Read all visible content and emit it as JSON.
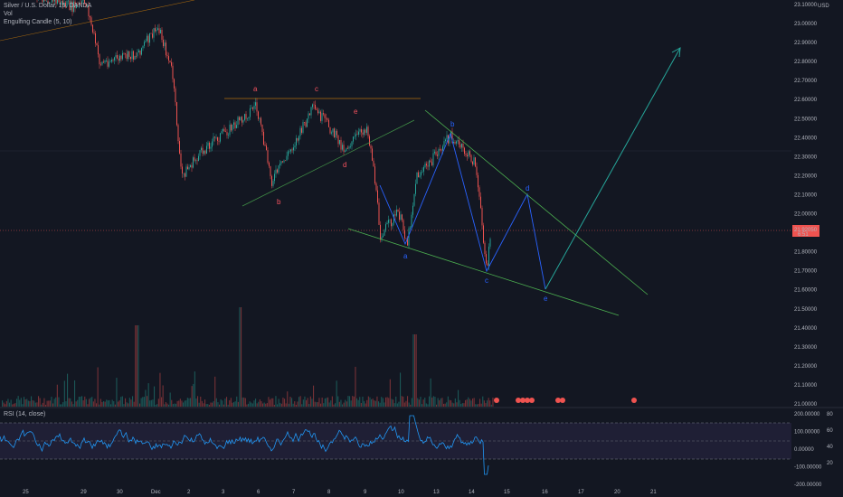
{
  "legend": {
    "symbol": "Silver / U.S. Dollar, 15, OANDA",
    "vol": "Vol",
    "indicator": "Engulfing Candle (5, 10)",
    "rsi": "RSI (14, close)"
  },
  "price_axis": {
    "currency": "USD",
    "current_price": "21.92050",
    "current_sub": "6:51"
  },
  "x_ticks": [
    "25",
    "29",
    "30",
    "Dec",
    "2",
    "3",
    "6",
    "7",
    "8",
    "9",
    "10",
    "13",
    "14",
    "15",
    "16",
    "17",
    "20",
    "21"
  ],
  "rsi_ticks": [
    "200.00000",
    "100.00000",
    "0.00000",
    "-100.00000",
    "-200.00000"
  ],
  "rsi_ticks_right": [
    "80",
    "60",
    "40",
    "20"
  ],
  "colors": {
    "background": "#131722",
    "up": "#26a69a",
    "down": "#ef5350",
    "rsi_line": "#2196f3",
    "rsi_band": "#7e57c2",
    "wave_red": "#f7525f",
    "wave_blue": "#2962ff",
    "trend_green": "#4caf50",
    "target_arrow": "#26a69a",
    "orange_line": "#ff9800"
  },
  "chart_data": {
    "type": "candlestick",
    "title": "Silver / U.S. Dollar, 15, OANDA",
    "y_axis": {
      "ticks": [
        21.0,
        21.1,
        21.2,
        21.3,
        21.4,
        21.5,
        21.6,
        21.7,
        21.8,
        21.9,
        22.0,
        22.1,
        22.2,
        22.3,
        22.4,
        22.5,
        22.6,
        22.7,
        22.8,
        22.9,
        23.0,
        23.1
      ],
      "tick_labels": [
        "21.00000",
        "21.10000",
        "21.20000",
        "21.30000",
        "21.40000",
        "21.50000",
        "21.60000",
        "21.70000",
        "21.80000",
        "21.90000",
        "22.00000",
        "22.10000",
        "22.20000",
        "22.30000",
        "22.40000",
        "22.50000",
        "22.60000",
        "22.70000",
        "22.80000",
        "22.90000",
        "23.00000",
        "23.10000"
      ],
      "range": [
        20.98,
        23.11
      ]
    },
    "price_path": [
      {
        "x": "25",
        "y": 23.1
      },
      {
        "x": "29",
        "y": 23.05
      },
      {
        "x": "29.5",
        "y": 22.8
      },
      {
        "x": "30",
        "y": 22.85
      },
      {
        "x": "Dec",
        "y": 22.6
      },
      {
        "x": "1.5",
        "y": 22.45
      },
      {
        "x": "2",
        "y": 22.3
      },
      {
        "x": "3",
        "y": 22.45
      },
      {
        "x": "3.5",
        "y": 22.6
      },
      {
        "x": "6",
        "y": 22.15
      },
      {
        "x": "7",
        "y": 22.45
      },
      {
        "x": "7.5",
        "y": 22.6
      },
      {
        "x": "8",
        "y": 22.45
      },
      {
        "x": "9",
        "y": 22.25
      },
      {
        "x": "9.3",
        "y": 21.95
      },
      {
        "x": "10",
        "y": 21.88
      },
      {
        "x": "10.5",
        "y": 22.15
      },
      {
        "x": "13",
        "y": 22.38
      },
      {
        "x": "14",
        "y": 22.25
      },
      {
        "x": "14.3",
        "y": 21.72
      },
      {
        "x": "14.5",
        "y": 21.92
      }
    ],
    "wave_labels": [
      "a",
      "b",
      "c",
      "d",
      "e",
      "a",
      "b",
      "c",
      "d",
      "e"
    ],
    "volume": "histogram",
    "rsi": {
      "name": "RSI (14, close)",
      "band_upper": 70,
      "band_lower": 30
    }
  }
}
